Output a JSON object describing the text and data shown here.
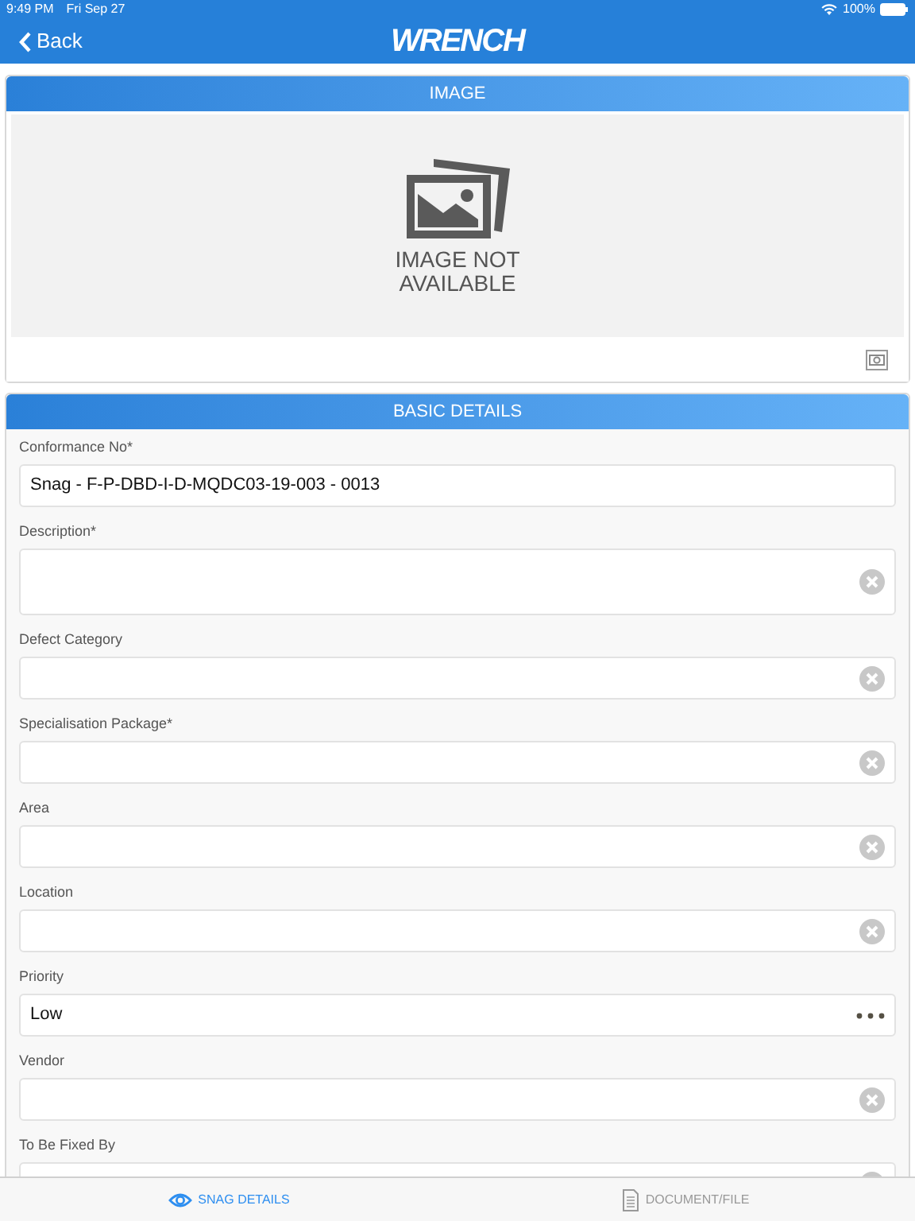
{
  "status_bar": {
    "time": "9:49 PM",
    "date": "Fri Sep 27",
    "battery": "100%"
  },
  "nav": {
    "back": "Back",
    "logo": "WRENCH"
  },
  "image_section": {
    "title": "IMAGE",
    "placeholder_text": "IMAGE NOT AVAILABLE"
  },
  "details_section": {
    "title": "BASIC DETAILS"
  },
  "fields": [
    {
      "label": "Conformance No*",
      "kind": "text",
      "value": "Snag - F-P-DBD-I-D-MQDC03-19-003 - 0013",
      "multiline": false
    },
    {
      "label": "Description*",
      "kind": "clear",
      "multiline": true
    },
    {
      "label": "Defect Category",
      "kind": "clear",
      "multiline": false
    },
    {
      "label": "Specialisation Package*",
      "kind": "clear",
      "multiline": false
    },
    {
      "label": "Area",
      "kind": "clear",
      "multiline": false
    },
    {
      "label": "Location",
      "kind": "clear",
      "multiline": false
    },
    {
      "label": "Priority",
      "kind": "more",
      "value": "Low",
      "multiline": false
    },
    {
      "label": "Vendor",
      "kind": "clear",
      "multiline": false
    },
    {
      "label": "To Be Fixed By",
      "kind": "clear",
      "multiline": false
    }
  ],
  "tabs": [
    {
      "label": "SNAG DETAILS",
      "kind": "eye",
      "selected": true
    },
    {
      "label": "DOCUMENT/FILE",
      "kind": "document",
      "selected": false
    }
  ]
}
